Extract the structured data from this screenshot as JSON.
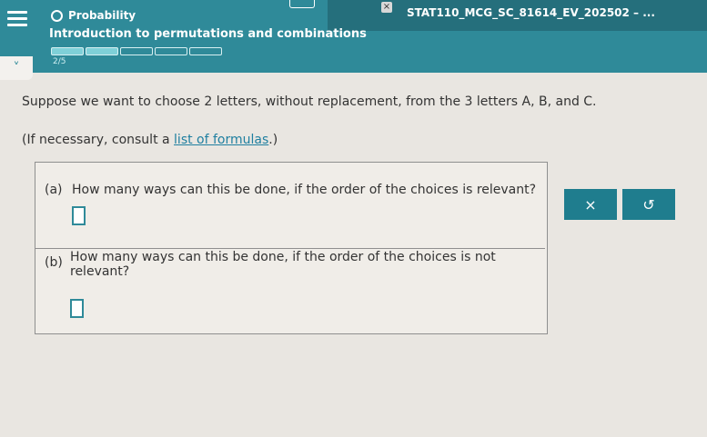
{
  "header": {
    "topic": "Probability",
    "title": "Introduction to permutations and combinations",
    "progress_text": "2/5",
    "progress_filled": 2,
    "progress_total": 5,
    "tab_title": "STAT110_MCG_SC_81614_EV_202502 – ...",
    "close_glyph": "×",
    "menu_icon": "hamburger-icon",
    "chevron": "˅"
  },
  "content": {
    "question": "Suppose we want to choose 2 letters, without replacement, from the 3 letters A, B, and C.",
    "note_prefix": "(If necessary, consult a ",
    "note_link": "list of formulas",
    "note_suffix": ".)",
    "part_a": {
      "label": "(a)",
      "text": "How many ways can this be done, if the order of the choices is relevant?"
    },
    "part_b": {
      "label": "(b)",
      "text": "How many ways can this be done, if the order of the choices is not relevant?"
    }
  },
  "buttons": {
    "clear": "×",
    "undo": "↺"
  },
  "colors": {
    "header": "#2f8a99",
    "accent": "#1f7d8e",
    "background": "#e9e6e1"
  }
}
